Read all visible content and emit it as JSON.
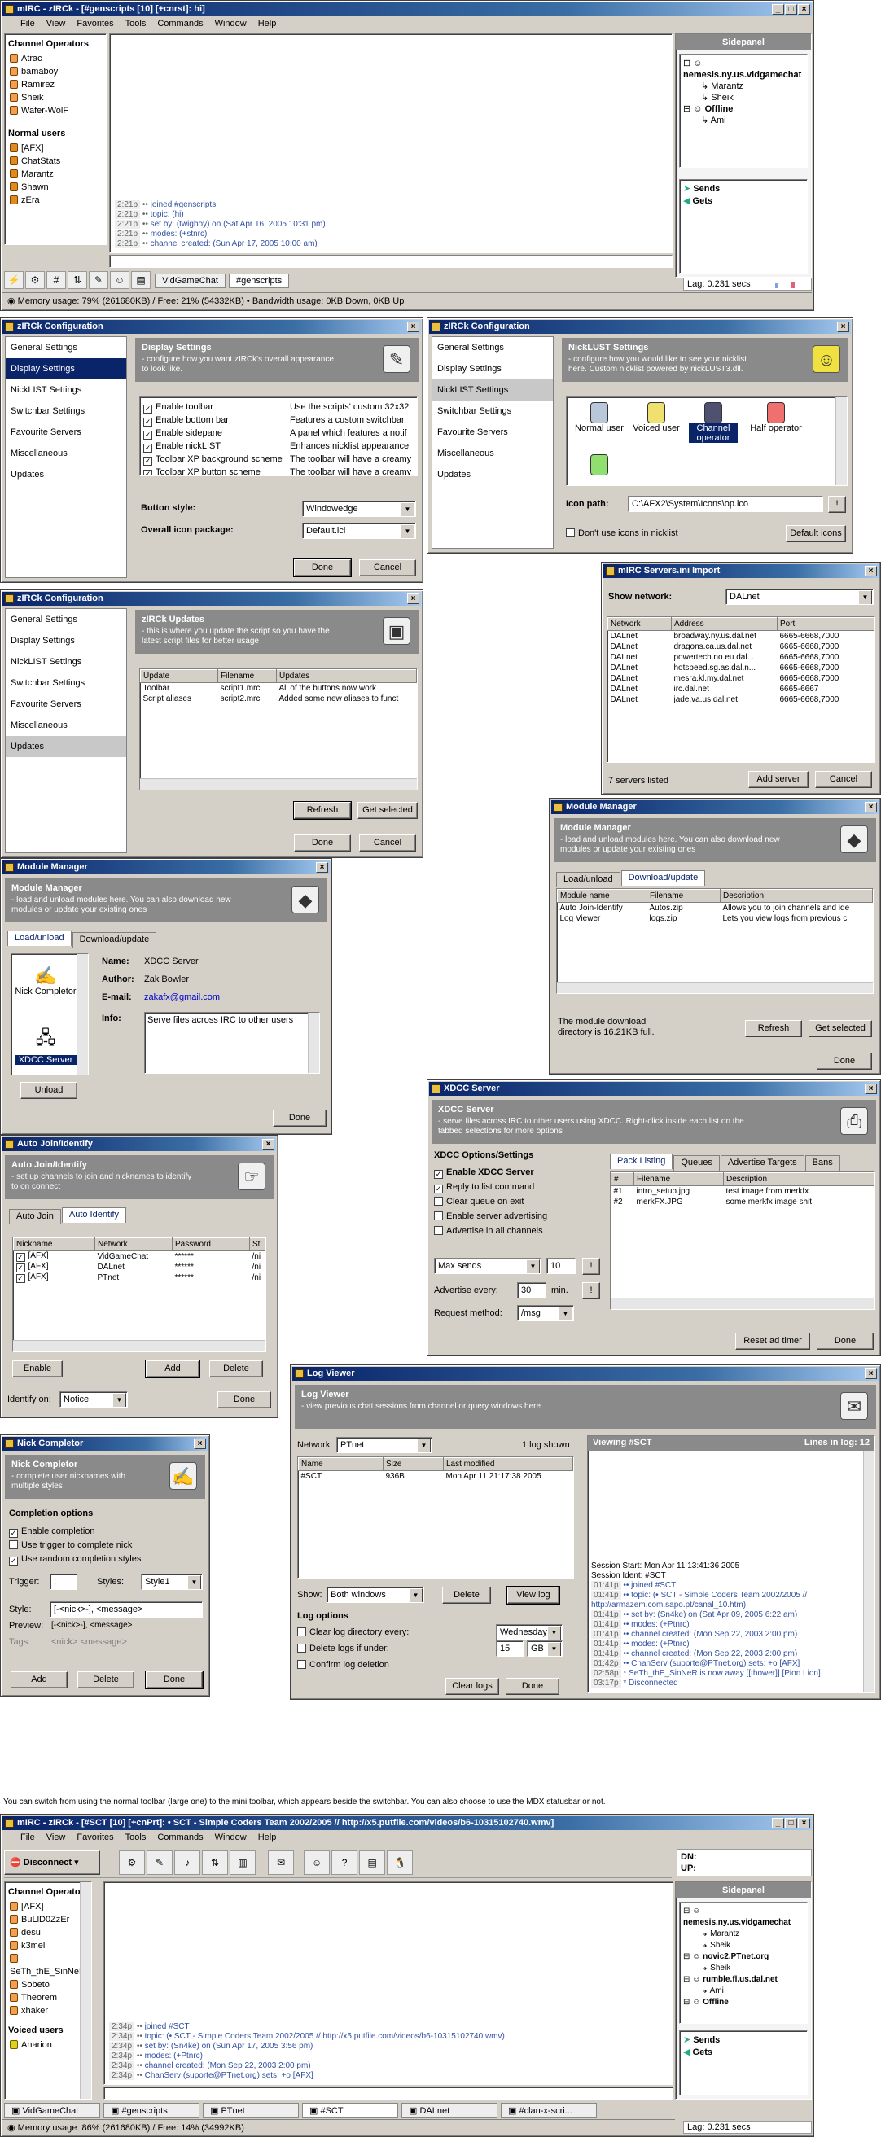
{
  "win1": {
    "title": "mIRC - zIRCk - [#genscripts [10] [+cnrst]: hi]",
    "menu": [
      "File",
      "View",
      "Favorites",
      "Tools",
      "Commands",
      "Window",
      "Help"
    ],
    "ops_header": "Channel Operators",
    "ops": [
      "Atrac",
      "bamaboy",
      "Ramirez",
      "Sheik",
      "Wafer-WolF"
    ],
    "users_header": "Normal users",
    "users": [
      "[AFX]",
      "ChatStats",
      "Marantz",
      "Shawn",
      "zEra"
    ],
    "sidepanel": "Sidepanel",
    "tree": [
      "nemesis.ny.us.vidgamechat",
      "Marantz",
      "Sheik",
      "Offline",
      "Ami"
    ],
    "sends": "Sends",
    "gets": "Gets",
    "log": [
      {
        "t": "2:21p",
        "x": "joined #genscripts"
      },
      {
        "t": "2:21p",
        "x": "topic: (hi)"
      },
      {
        "t": "2:21p",
        "x": "set by: (twigboy) on (Sat Apr 16, 2005 10:31 pm)"
      },
      {
        "t": "2:21p",
        "x": "modes: (+stnrc)"
      },
      {
        "t": "2:21p",
        "x": "channel created: (Sun Apr 17, 2005 10:00 am)"
      }
    ],
    "switch": [
      "VidGameChat",
      "#genscripts"
    ],
    "lag": "Lag: 0.231 secs",
    "status": "Memory usage: 79% (261680KB) / Free: 21% (54332KB)  •  Bandwidth usage: 0KB Down, 0KB Up"
  },
  "config": {
    "title": "zIRCk Configuration",
    "nav": [
      "General Settings",
      "Display Settings",
      "NickLIST Settings",
      "Switchbar Settings",
      "Favourite Servers",
      "Miscellaneous",
      "Updates"
    ],
    "done": "Done",
    "cancel": "Cancel"
  },
  "display": {
    "head": "Display Settings",
    "desc": "- configure how you want zIRCk's overall appearance to look like.",
    "rows": [
      [
        "Enable toolbar",
        "Use the scripts' custom 32x32"
      ],
      [
        "Enable bottom bar",
        "Features a custom switchbar,"
      ],
      [
        "Enable sidepane",
        "A panel which features a notif"
      ],
      [
        "Enable nickLIST",
        "Enhances nicklist appearance"
      ],
      [
        "Toolbar XP background scheme",
        "The toolbar will have a creamy"
      ],
      [
        "Toolbar XP button scheme",
        "The toolbar will have a creamy"
      ]
    ],
    "button_style_label": "Button style:",
    "button_style": "Windowedge",
    "icon_package_label": "Overall icon package:",
    "icon_package": "Default.icl"
  },
  "nicklist": {
    "head": "NickLUST Settings",
    "desc": "- configure how you would like to see your nicklist here. Custom nicklist powered by nickLUST3.dll.",
    "icons": [
      "Normal user",
      "Voiced user",
      "Channel operator",
      "Half operator",
      ""
    ],
    "icon_path_label": "Icon path:",
    "icon_path": "C:\\AFX2\\System\\Icons\\op.ico",
    "browse": "!",
    "dont_use": "Don't use icons in nicklist",
    "default_icons": "Default icons"
  },
  "updates": {
    "head": "zIRCk Updates",
    "desc": "- this is where you update the script so you have the latest script files for better usage",
    "cols": [
      "Update",
      "Filename",
      "Updates"
    ],
    "rows": [
      [
        "Toolbar",
        "script1.mrc",
        "All of the buttons now work"
      ],
      [
        "Script aliases",
        "script2.mrc",
        "Added some new aliases to funct"
      ]
    ],
    "refresh": "Refresh",
    "get_selected": "Get selected"
  },
  "servers": {
    "title": "mIRC Servers.ini Import",
    "show_label": "Show network:",
    "network": "DALnet",
    "cols": [
      "Network",
      "Address",
      "Port"
    ],
    "rows": [
      [
        "DALnet",
        "broadway.ny.us.dal.net",
        "6665-6668,7000"
      ],
      [
        "DALnet",
        "dragons.ca.us.dal.net",
        "6665-6668,7000"
      ],
      [
        "DALnet",
        "powertech.no.eu.dal...",
        "6665-6668,7000"
      ],
      [
        "DALnet",
        "hotspeed.sg.as.dal.n...",
        "6665-6668,7000"
      ],
      [
        "DALnet",
        "mesra.kl.my.dal.net",
        "6665-6668,7000"
      ],
      [
        "DALnet",
        "irc.dal.net",
        "6665-6667"
      ],
      [
        "DALnet",
        "jade.va.us.dal.net",
        "6665-6668,7000"
      ]
    ],
    "count": "7 servers listed",
    "add": "Add server",
    "cancel": "Cancel"
  },
  "mm_right": {
    "title": "Module Manager",
    "head": "Module Manager",
    "desc": "- load and unload modules here. You can also download new modules or update your existing ones",
    "tabs": [
      "Load/unload",
      "Download/update"
    ],
    "cols": [
      "Module name",
      "Filename",
      "Description"
    ],
    "rows": [
      [
        "Auto Join-Identify",
        "Autos.zip",
        "Allows you to join channels and ide"
      ],
      [
        "Log Viewer",
        "logs.zip",
        "Lets you view logs from previous c"
      ]
    ],
    "dir": "The module download directory is 16.21KB full.",
    "refresh": "Refresh",
    "get_selected": "Get selected",
    "done": "Done"
  },
  "mm_left": {
    "title": "Module Manager",
    "head": "Module Manager",
    "desc": "- load and unload modules here. You can also download new modules or update your existing ones",
    "tabs": [
      "Load/unload",
      "Download/update"
    ],
    "modules": [
      "Nick Completor",
      "XDCC Server"
    ],
    "unload": "Unload",
    "name_l": "Name:",
    "name": "XDCC Server",
    "author_l": "Author:",
    "author": "Zak Bowler",
    "email_l": "E-mail:",
    "email": "zakafx@gmail.com",
    "info_l": "Info:",
    "info": "Serve files across IRC to other users",
    "done": "Done"
  },
  "xdcc": {
    "title": "XDCC Server",
    "head": "XDCC Server",
    "desc": "- serve files across IRC to other users using XDCC. Right-click inside each list on the tabbed selections for more options",
    "opts_title": "XDCC Options/Settings",
    "opts": [
      {
        "l": "Enable XDCC Server",
        "c": true,
        "b": true
      },
      {
        "l": "Reply to list command",
        "c": true
      },
      {
        "l": "Clear queue on exit",
        "c": false
      },
      {
        "l": "Enable server advertising",
        "c": false
      },
      {
        "l": "Advertise in all channels",
        "c": false
      }
    ],
    "max_sends": "Max sends",
    "max_val": "10",
    "adv_l": "Advertise every:",
    "adv_val": "30",
    "min": "min.",
    "req_l": "Request method:",
    "req": "/msg",
    "tabs": [
      "Pack Listing",
      "Queues",
      "Advertise Targets",
      "Bans"
    ],
    "cols": [
      "#",
      "Filename",
      "Description"
    ],
    "rows": [
      [
        "#1",
        "intro_setup.jpg",
        "test image from merkfx"
      ],
      [
        "#2",
        "merkFX.JPG",
        "some merkfx image shit"
      ]
    ],
    "reset": "Reset ad timer",
    "done": "Done"
  },
  "autojoin": {
    "title": "Auto Join/Identify",
    "head": "Auto Join/Identify",
    "desc": "- set up channels to join and nicknames to identify to on connect",
    "tabs": [
      "Auto Join",
      "Auto Identify"
    ],
    "cols": [
      "Nickname",
      "Network",
      "Password",
      "St"
    ],
    "rows": [
      [
        "[AFX]",
        "VidGameChat",
        "******",
        "/ni"
      ],
      [
        "[AFX]",
        "DALnet",
        "******",
        "/ni"
      ],
      [
        "[AFX]",
        "PTnet",
        "******",
        "/ni"
      ]
    ],
    "enable": "Enable",
    "add": "Add",
    "delete": "Delete",
    "identify_l": "Identify on:",
    "identify": "Notice",
    "done": "Done"
  },
  "nickc": {
    "title": "Nick Completor",
    "head": "Nick Completor",
    "desc": "- complete user nicknames with multiple styles",
    "opts_title": "Completion options",
    "opts": [
      {
        "l": "Enable completion",
        "c": true
      },
      {
        "l": "Use trigger to complete nick",
        "c": false
      },
      {
        "l": "Use random completion styles",
        "c": true
      }
    ],
    "trigger_l": "Trigger:",
    "trigger": ";",
    "styles_l": "Styles:",
    "styles": "Style1",
    "style_l": "Style:",
    "style": "[-<nick>-], <message>",
    "preview_l": "Preview:",
    "preview": "[-<nick>-], <message>",
    "tags_l": "Tags:",
    "tags": "<nick> <message>",
    "add": "Add",
    "delete": "Delete",
    "done": "Done"
  },
  "logv": {
    "title": "Log Viewer",
    "head": "Log Viewer",
    "desc": "- view previous chat sessions from channel or query windows here",
    "network_l": "Network:",
    "network": "PTnet",
    "count": "1 log shown",
    "cols": [
      "Name",
      "Size",
      "Last modified"
    ],
    "rows": [
      [
        "#SCT",
        "936B",
        "Mon Apr 11 21:17:38 2005"
      ]
    ],
    "show_l": "Show:",
    "show": "Both windows",
    "delete": "Delete",
    "view": "View log",
    "opts_title": "Log options",
    "opt1": "Clear log directory every:",
    "opt1v": "Wednesday",
    "opt2": "Delete logs if under:",
    "opt2v": "15",
    "opt2u": "GB",
    "opt3": "Confirm log deletion",
    "clear": "Clear logs",
    "done": "Done",
    "viewing": "Viewing #SCT",
    "lines": "Lines in log: 12",
    "log": [
      {
        "t": "",
        "x": "Session Start: Mon Apr 11 13:41:36 2005"
      },
      {
        "t": "",
        "x": "Session Ident: #SCT"
      },
      {
        "t": "01:41p",
        "x": "•• joined #SCT"
      },
      {
        "t": "01:41p",
        "x": "•• topic: (• SCT - Simple Coders Team 2002/2005 // http://armazem.com.sapo.pt/canal_10.htm)"
      },
      {
        "t": "01:41p",
        "x": "•• set by: (Sn4ke) on (Sat Apr 09, 2005 6:22 am)"
      },
      {
        "t": "01:41p",
        "x": "•• modes: (+Ptnrc)"
      },
      {
        "t": "01:41p",
        "x": "•• channel created: (Mon Sep 22, 2003 2:00 pm)"
      },
      {
        "t": "01:41p",
        "x": "•• modes: (+Ptnrc)"
      },
      {
        "t": "01:41p",
        "x": "•• channel created: (Mon Sep 22, 2003 2:00 pm)"
      },
      {
        "t": "01:42p",
        "x": "•• ChanServ (suporte@PTnet.org) sets: +o [AFX]"
      },
      {
        "t": "02:58p",
        "x": "* SeTh_thE_SinNeR is now away [[thower]] [Pion Lion]"
      },
      {
        "t": "03:17p",
        "x": "* Disconnected"
      }
    ]
  },
  "caption": "You can switch from using the normal toolbar (large one) to the mini toolbar, which appears beside the switchbar. You can also choose to use the MDX statusbar or not.",
  "win2": {
    "title": "mIRC - zIRCk - [#SCT [10] [+cnPrt]: • SCT - Simple Coders Team 2002/2005 // http://x5.putfile.com/videos/b6-10315102740.wmv]",
    "menu": [
      "File",
      "View",
      "Favorites",
      "Tools",
      "Commands",
      "Window",
      "Help"
    ],
    "disconnect": "Disconnect",
    "dn": "DN:",
    "up": "UP:",
    "sidepanel": "Sidepanel",
    "tree": [
      "nemesis.ny.us.vidgamechat",
      "Marantz",
      "Sheik",
      "novic2.PTnet.org",
      "Sheik",
      "rumble.fl.us.dal.net",
      "Ami",
      "Offline"
    ],
    "sends": "Sends",
    "gets": "Gets",
    "ops_header": "Channel Operators",
    "ops": [
      "[AFX]",
      "BuLlD0ZzEr",
      "desu",
      "k3mel",
      "SeTh_thE_SinNeR",
      "Sobeto",
      "Theorem",
      "xhaker"
    ],
    "voiced_header": "Voiced users",
    "voiced": [
      "Anarion"
    ],
    "log": [
      {
        "t": "2:34p",
        "x": "joined #SCT"
      },
      {
        "t": "2:34p",
        "x": "topic: (• SCT - Simple Coders Team 2002/2005 // http://x5.putfile.com/videos/b6-10315102740.wmv)"
      },
      {
        "t": "2:34p",
        "x": "set by: (Sn4ke) on (Sun Apr 17, 2005 3:56 pm)"
      },
      {
        "t": "2:34p",
        "x": "modes: (+Ptnrc)"
      },
      {
        "t": "2:34p",
        "x": "channel created: (Mon Sep 22, 2003 2:00 pm)"
      },
      {
        "t": "2:34p",
        "x": "ChanServ (suporte@PTnet.org) sets: +o [AFX]"
      }
    ],
    "switch": [
      "VidGameChat",
      "#genscripts",
      "PTnet",
      "#SCT",
      "DALnet",
      "#clan-x-scri..."
    ],
    "lag": "Lag: 0.231 secs",
    "status": "Memory usage: 86% (261680KB) / Free: 14% (34992KB)"
  }
}
